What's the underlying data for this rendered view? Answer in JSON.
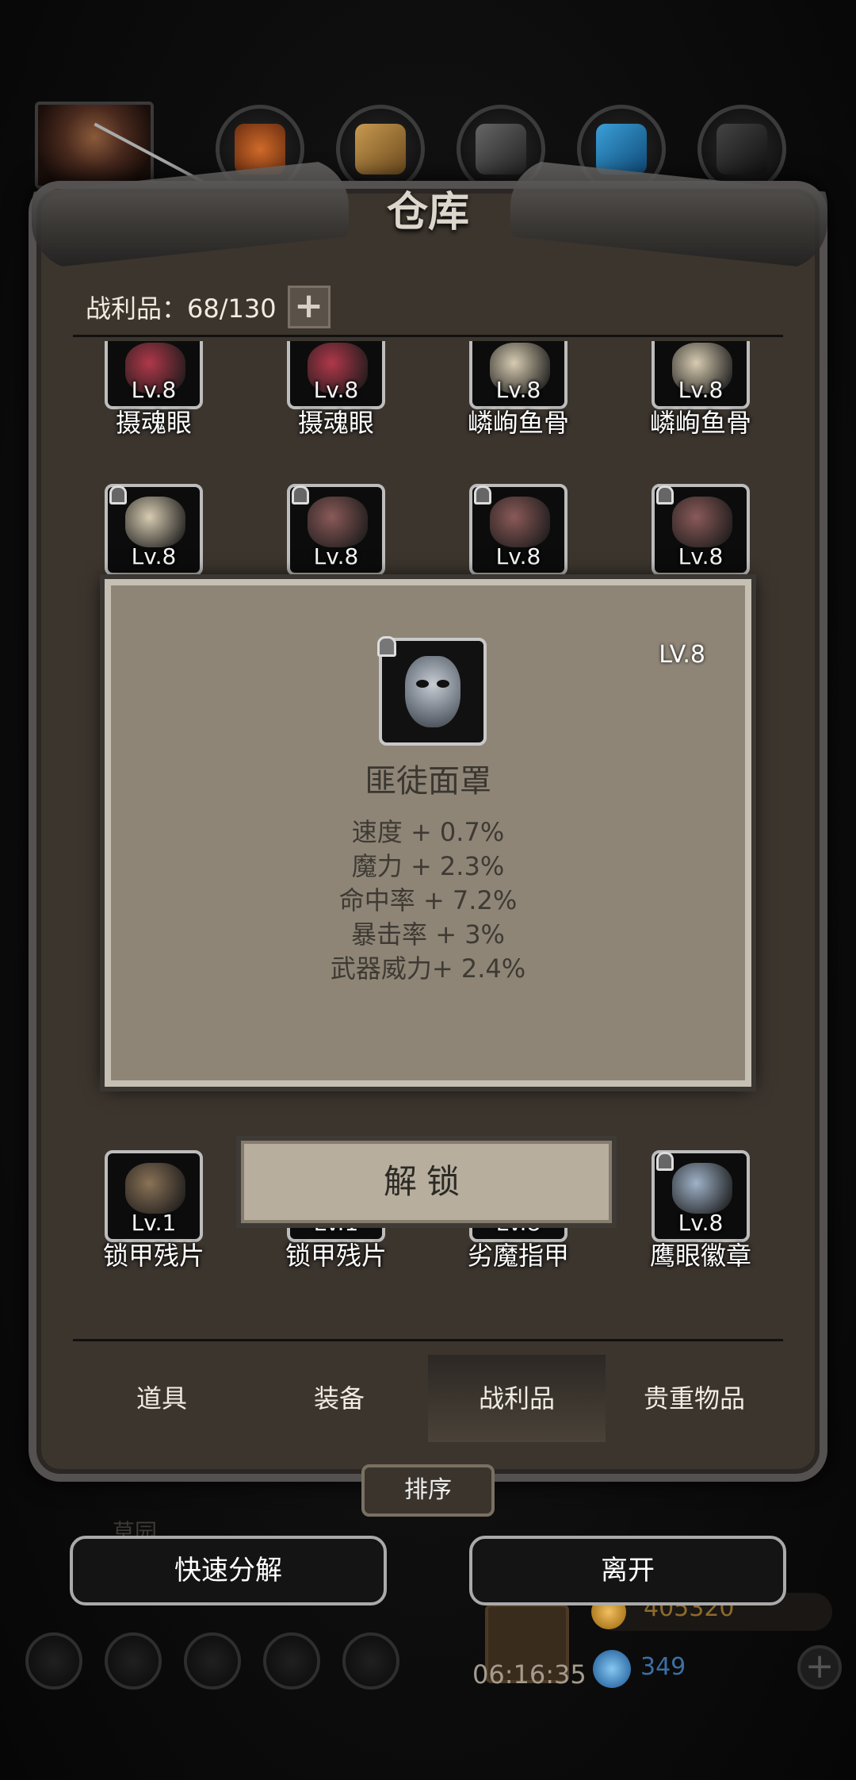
{
  "window": {
    "title": "仓库"
  },
  "capacity": {
    "label": "战利品：68/130",
    "plus": "+"
  },
  "items": [
    {
      "name": "摄魂眼",
      "level": "Lv.8",
      "color": "#b0384a",
      "locked": false
    },
    {
      "name": "摄魂眼",
      "level": "Lv.8",
      "color": "#b0384a",
      "locked": false
    },
    {
      "name": "嶙峋鱼骨",
      "level": "Lv.8",
      "color": "#d7cbb1",
      "locked": false
    },
    {
      "name": "嶙峋鱼骨",
      "level": "Lv.8",
      "color": "#d7cbb1",
      "locked": false
    },
    {
      "name": "",
      "level": "Lv.8",
      "color": "#d7cbb1",
      "locked": true
    },
    {
      "name": "",
      "level": "Lv.8",
      "color": "#8a5a58",
      "locked": true
    },
    {
      "name": "",
      "level": "Lv.8",
      "color": "#8a5a58",
      "locked": true
    },
    {
      "name": "",
      "level": "Lv.8",
      "color": "#8a5a58",
      "locked": true
    },
    {
      "name": "匪徒面罩",
      "level": "",
      "color": "#888",
      "locked": false
    },
    {
      "name": "匪徒面罩",
      "level": "",
      "color": "#888",
      "locked": false
    },
    {
      "name": "匪徒面罩",
      "level": "",
      "color": "#888",
      "locked": false
    },
    {
      "name": "锁甲残片",
      "level": "",
      "color": "#888",
      "locked": false
    },
    {
      "name": "锁甲残片",
      "level": "Lv.1",
      "color": "#8a7256",
      "locked": false
    },
    {
      "name": "锁甲残片",
      "level": "Lv.1",
      "color": "#8a7256",
      "locked": false
    },
    {
      "name": "劣魔指甲",
      "level": "Lv.8",
      "color": "#6e5a4a",
      "locked": false
    },
    {
      "name": "鹰眼徽章",
      "level": "Lv.8",
      "color": "#9fb2c8",
      "locked": true
    }
  ],
  "popup": {
    "level": "LV.8",
    "name": "匪徒面罩",
    "stats": [
      "速度 + 0.7%",
      "魔力 + 2.3%",
      "命中率 + 7.2%",
      "暴击率 + 3%",
      "武器威力+ 2.4%"
    ]
  },
  "unlock_button": "解锁",
  "tabs": [
    "道具",
    "装备",
    "战利品",
    "贵重物品"
  ],
  "active_tab": "战利品",
  "sort_button": "排序",
  "actions": {
    "decompose": "快速分解",
    "leave": "离开"
  },
  "background_hud": {
    "timer": "06:16:35",
    "gold": "405320",
    "gems": "349",
    "label": "草园"
  },
  "category_tabs": [
    "copper-ore-icon",
    "wood-icon",
    "iron-ingot-icon",
    "blue-feather-icon",
    "dark-ingot-icon"
  ]
}
